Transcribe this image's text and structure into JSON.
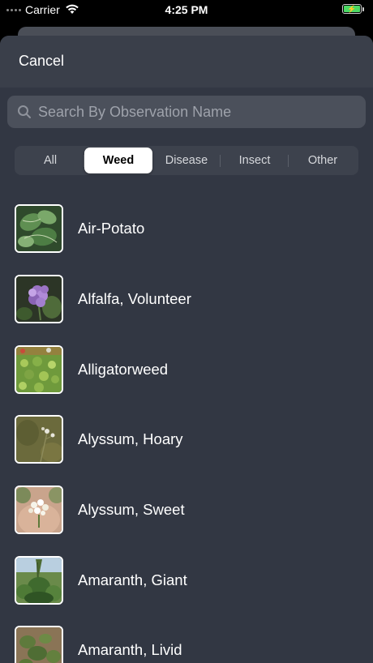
{
  "status_bar": {
    "carrier": "Carrier",
    "time": "4:25 PM",
    "battery_charging": true
  },
  "header": {
    "cancel_label": "Cancel"
  },
  "search": {
    "placeholder": "Search By Observation Name",
    "value": ""
  },
  "filters": {
    "items": [
      {
        "label": "All",
        "selected": false
      },
      {
        "label": "Weed",
        "selected": true
      },
      {
        "label": "Disease",
        "selected": false
      },
      {
        "label": "Insect",
        "selected": false
      },
      {
        "label": "Other",
        "selected": false
      }
    ]
  },
  "observations": [
    {
      "name": "Air-Potato",
      "thumbnail": "leafy-vine-photo"
    },
    {
      "name": "Alfalfa, Volunteer",
      "thumbnail": "purple-flower-photo"
    },
    {
      "name": "Alligatorweed",
      "thumbnail": "green-mat-photo"
    },
    {
      "name": "Alyssum, Hoary",
      "thumbnail": "white-flower-stem-photo"
    },
    {
      "name": "Alyssum, Sweet",
      "thumbnail": "white-flower-cluster-photo"
    },
    {
      "name": "Amaranth, Giant",
      "thumbnail": "tall-plant-field-photo"
    },
    {
      "name": "Amaranth, Livid",
      "thumbnail": "ground-weed-photo"
    }
  ],
  "colors": {
    "sheet": "#323743",
    "header": "#3a3f4a",
    "search": "#4b505b",
    "segment_bg": "#3d424d",
    "segment_active": "#ffffff",
    "battery": "#4cd964"
  }
}
